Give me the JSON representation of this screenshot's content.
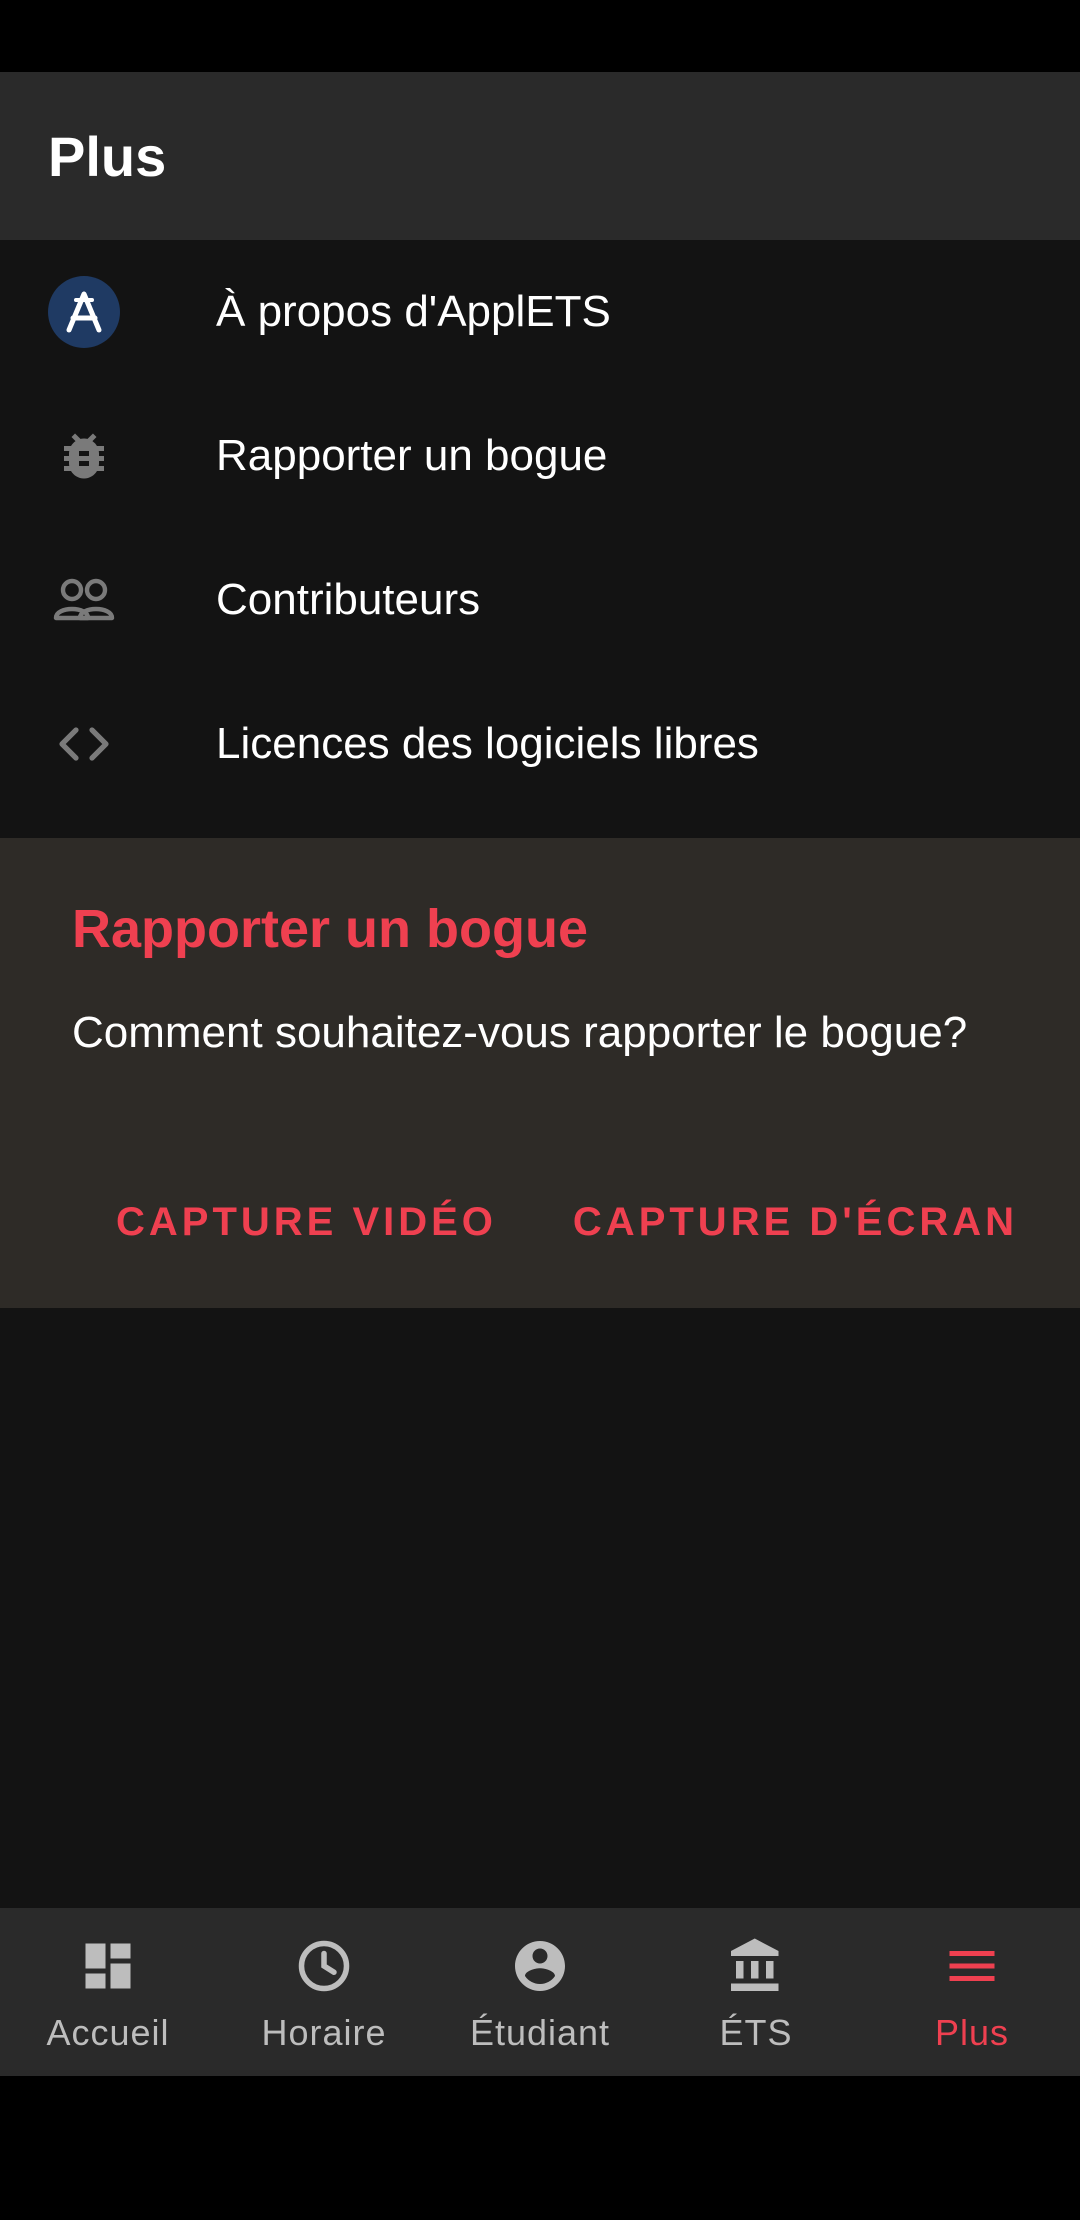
{
  "app_bar": {
    "title": "Plus"
  },
  "menu": {
    "items": [
      {
        "label": "À propos d'ApplETS",
        "icon": "applets-logo-icon"
      },
      {
        "label": "Rapporter un bogue",
        "icon": "bug-icon"
      },
      {
        "label": "Contributeurs",
        "icon": "people-icon"
      },
      {
        "label": "Licences des logiciels libres",
        "icon": "code-icon"
      }
    ]
  },
  "dialog": {
    "title": "Rapporter un bogue",
    "body": "Comment souhaitez-vous rapporter le bogue?",
    "actions": {
      "video": "CAPTURE VIDÉO",
      "screenshot": "CAPTURE D'ÉCRAN"
    }
  },
  "bottom_nav": {
    "items": [
      {
        "label": "Accueil",
        "icon": "dashboard-icon",
        "active": false
      },
      {
        "label": "Horaire",
        "icon": "clock-icon",
        "active": false
      },
      {
        "label": "Étudiant",
        "icon": "account-circle-icon",
        "active": false
      },
      {
        "label": "ÉTS",
        "icon": "institution-icon",
        "active": false
      },
      {
        "label": "Plus",
        "icon": "menu-icon",
        "active": true
      }
    ]
  },
  "colors": {
    "accent": "#ef4050",
    "app_bar_bg": "#2a2a2a",
    "content_bg": "#131313",
    "dialog_bg": "#2e2b27",
    "icon_gray": "#7a7a7a",
    "logo_bg": "#1f3a63"
  }
}
